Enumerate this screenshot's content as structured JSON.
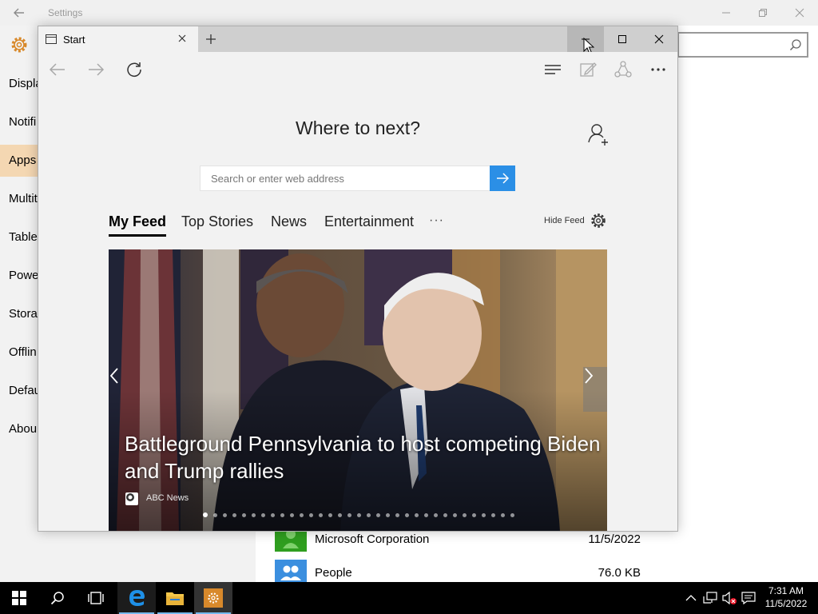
{
  "settings": {
    "title": "Settings",
    "sidebar": {
      "items": [
        {
          "label": "Displa"
        },
        {
          "label": "Notifi"
        },
        {
          "label": "Apps"
        },
        {
          "label": "Multit"
        },
        {
          "label": "Tablet"
        },
        {
          "label": "Powe"
        },
        {
          "label": "Storag"
        },
        {
          "label": "Offlin"
        },
        {
          "label": "Defau"
        },
        {
          "label": "Abou"
        }
      ],
      "active_item": "Apps"
    },
    "apps": [
      {
        "name": "Microsoft Corporation",
        "meta": "11/5/2022",
        "tile_color": "#2f9e1f"
      },
      {
        "name": "People",
        "meta": "76.0 KB",
        "tile_color": "#3b8fdf"
      }
    ]
  },
  "edge": {
    "tab_title": "Start",
    "heading": "Where to next?",
    "search": {
      "placeholder": "Search or enter web address",
      "value": ""
    },
    "feed_tabs": [
      "My Feed",
      "Top Stories",
      "News",
      "Entertainment"
    ],
    "active_feed_tab": "My Feed",
    "more_tabs": "···",
    "hide_feed_label": "Hide Feed",
    "hero": {
      "headline": "Battleground Pennsylvania to host competing Biden and Trump rallies",
      "source": "ABC News",
      "slide_count": 33,
      "active_slide": 1
    },
    "accent_color": "#2b8fe6"
  },
  "taskbar": {
    "clock_time": "7:31 AM",
    "clock_date": "11/5/2022",
    "running_apps": [
      "edge",
      "file-explorer",
      "settings"
    ]
  }
}
